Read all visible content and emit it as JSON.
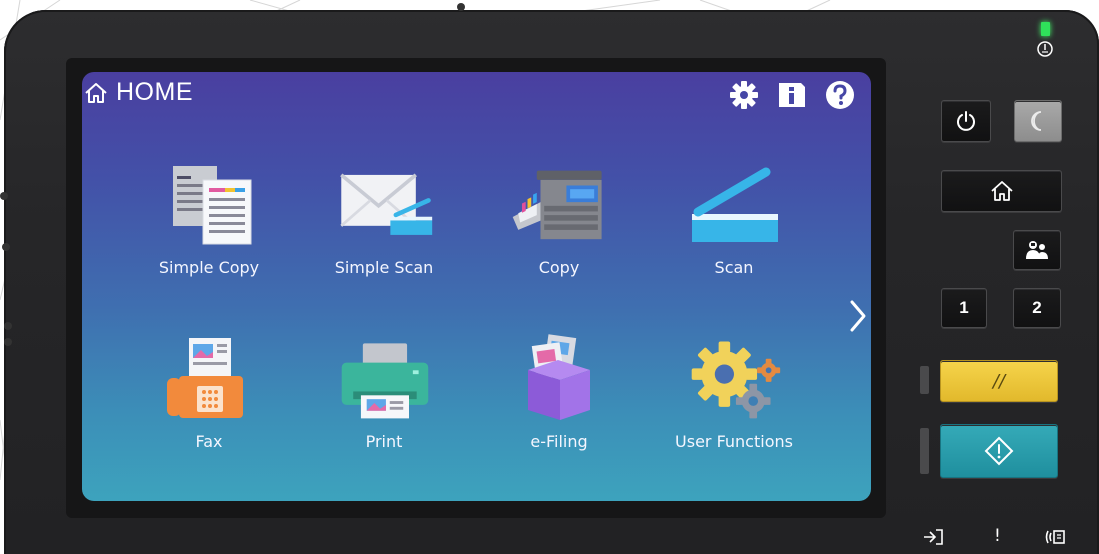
{
  "header": {
    "title": "HOME",
    "icons": [
      "home-icon",
      "gear-icon",
      "info-icon",
      "help-icon"
    ]
  },
  "apps": [
    {
      "label": "Simple Copy",
      "icon": "simple-copy-icon"
    },
    {
      "label": "Simple Scan",
      "icon": "simple-scan-icon"
    },
    {
      "label": "Copy",
      "icon": "copy-icon"
    },
    {
      "label": "Scan",
      "icon": "scan-icon"
    },
    {
      "label": "Fax",
      "icon": "fax-icon"
    },
    {
      "label": "Print",
      "icon": "print-icon"
    },
    {
      "label": "e-Filing",
      "icon": "efiling-icon"
    },
    {
      "label": "User Functions",
      "icon": "user-functions-icon"
    }
  ],
  "hardware": {
    "memory1": "1",
    "memory2": "2",
    "clear_symbol": "//",
    "bottom_indicators": [
      "data-in-icon",
      "!",
      "fax-line-icon"
    ]
  },
  "colors": {
    "screen_top": "#4a3fa0",
    "screen_bottom": "#3da3bd",
    "clear_button": "#f6d44b",
    "start_button": "#2aa0ae",
    "power_led": "#2fe05a"
  }
}
